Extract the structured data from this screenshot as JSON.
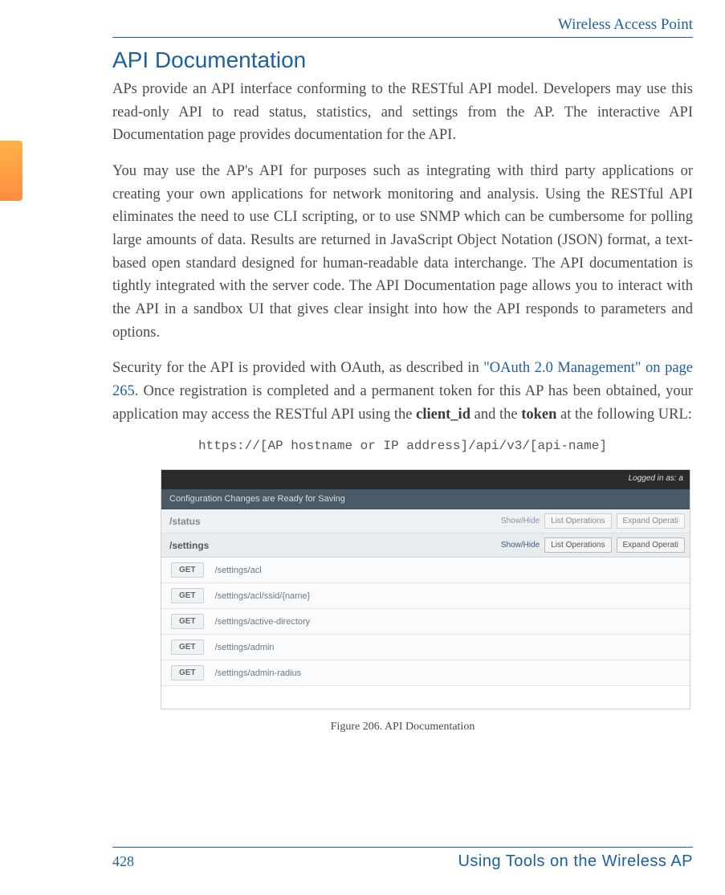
{
  "header": {
    "title": "Wireless Access Point"
  },
  "section": {
    "heading": "API Documentation"
  },
  "paragraphs": {
    "p1": "APs provide an API interface conforming to the RESTful API model. Developers may use this read-only API to read status, statistics, and settings from the AP. The interactive API Documentation page provides documentation for the API.",
    "p2": "You may use the AP's API for purposes such as integrating with third party applications or creating your own applications for network monitoring and analysis. Using the RESTful API eliminates the need to use CLI scripting, or to use SNMP which can be cumbersome for polling large amounts of data. Results are returned in JavaScript Object Notation (JSON) format, a text-based open standard designed for human-readable data interchange. The API documentation is tightly integrated with the server code. The API Documentation page allows you to interact with the API in a sandbox UI that gives clear insight into how the API responds to parameters and options.",
    "p3_pre": "Security for the API is provided with OAuth, as described in ",
    "p3_link": "\"OAuth 2.0 Management\" on page 265",
    "p3_mid": ". Once registration is completed and a permanent token for this AP has been obtained, your application may access the RESTful API using the ",
    "p3_bold1": "client_id",
    "p3_mid2": " and the ",
    "p3_bold2": "token",
    "p3_post": " at the following URL:"
  },
  "code_url": "https://[AP hostname or IP address]/api/v3/[api-name]",
  "screenshot": {
    "topbar": "Logged in as: a",
    "banner": "Configuration Changes are Ready for Saving",
    "sections": [
      {
        "path": "/status",
        "show": "Show/Hide",
        "list": "List Operations",
        "expand": "Expand Operati",
        "active": false
      },
      {
        "path": "/settings",
        "show": "Show/Hide",
        "list": "List Operations",
        "expand": "Expand Operati",
        "active": true
      }
    ],
    "rows": [
      {
        "method": "GET",
        "path": "/settings/acl"
      },
      {
        "method": "GET",
        "path": "/settings/acl/ssid/{name}"
      },
      {
        "method": "GET",
        "path": "/settings/active-directory"
      },
      {
        "method": "GET",
        "path": "/settings/admin"
      },
      {
        "method": "GET",
        "path": "/settings/admin-radius"
      }
    ]
  },
  "figure_caption": "Figure 206. API Documentation",
  "footer": {
    "page": "428",
    "title": "Using Tools on the Wireless AP"
  }
}
